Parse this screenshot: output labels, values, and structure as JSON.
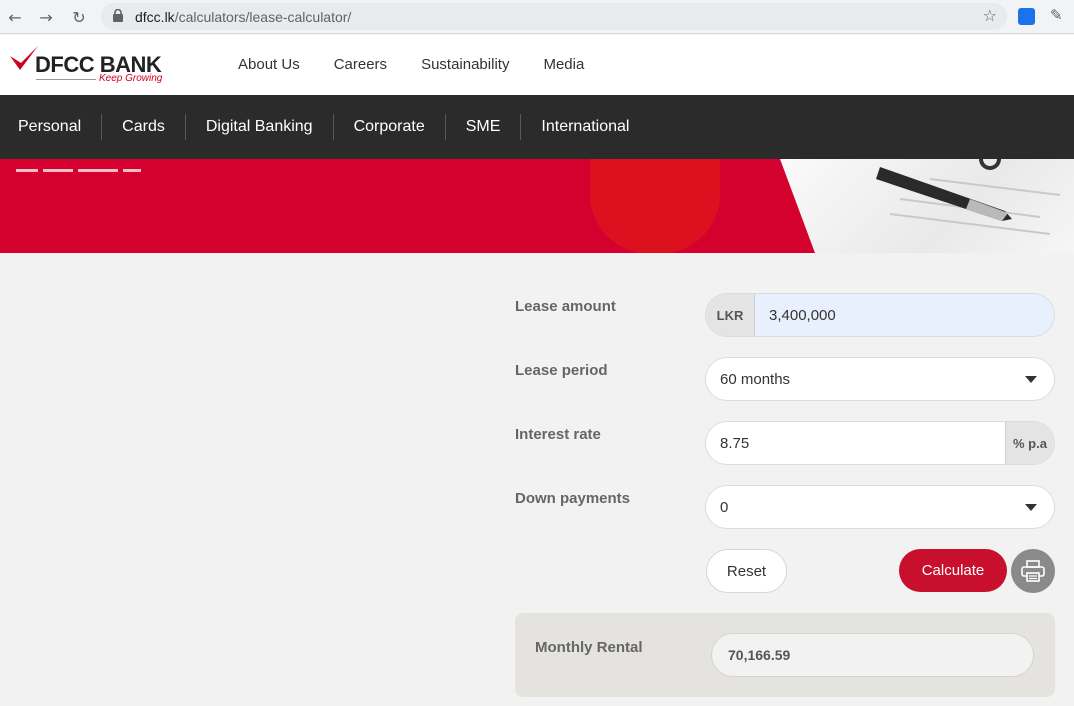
{
  "browser": {
    "url_host": "dfcc.lk",
    "url_path": "/calculators/lease-calculator/"
  },
  "brand": {
    "name": "DFCC BANK",
    "tagline": "Keep Growing",
    "color_primary": "#c8102e"
  },
  "top_nav": [
    "About Us",
    "Careers",
    "Sustainability",
    "Media"
  ],
  "main_nav": [
    "Personal",
    "Cards",
    "Digital Banking",
    "Corporate",
    "SME",
    "International"
  ],
  "form": {
    "lease_amount": {
      "label": "Lease amount",
      "prefix": "LKR",
      "value": "3,400,000"
    },
    "lease_period": {
      "label": "Lease period",
      "value": "60 months"
    },
    "interest_rate": {
      "label": "Interest rate",
      "value": "8.75",
      "suffix": "% p.a"
    },
    "down_payments": {
      "label": "Down payments",
      "value": "0"
    }
  },
  "buttons": {
    "reset": "Reset",
    "calculate": "Calculate"
  },
  "result": {
    "label": "Monthly Rental",
    "value": "70,166.59"
  }
}
